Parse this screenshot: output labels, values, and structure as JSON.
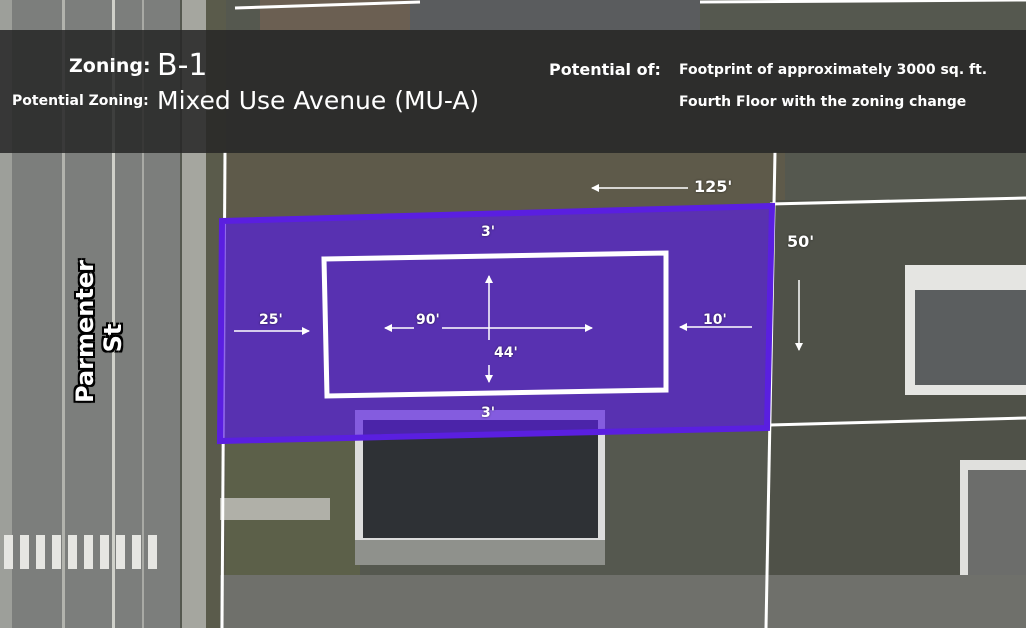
{
  "header": {
    "zoning_label": "Zoning:",
    "zoning_value": "B-1",
    "potential_zoning_label": "Potential Zoning:",
    "potential_zoning_value": "Mixed Use Avenue (MU-A)",
    "potential_of_label": "Potential of:",
    "potential_items": [
      "Footprint of approximately 3000 sq. ft.",
      "Fourth Floor with the zoning change"
    ]
  },
  "map": {
    "street_name": "Parmenter St",
    "lot_color": "#5a1fe0",
    "dimensions": {
      "lot_length": "125'",
      "lot_width": "50'",
      "front_setback": "25'",
      "rear_setback": "10'",
      "side_setback_top": "3'",
      "side_setback_bottom": "3'",
      "building_length": "90'",
      "building_width": "44'"
    }
  }
}
